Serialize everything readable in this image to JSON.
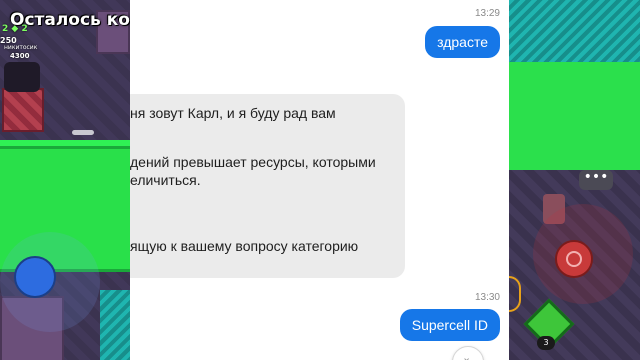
{
  "game": {
    "title": "Осталось ком",
    "stats_left": "2",
    "stats_gems": "2",
    "player_name": "никитосик",
    "player_score": "4300",
    "hp_left": "250",
    "super_count": "3",
    "chat_dots": "•••"
  },
  "chat": {
    "messages": [
      {
        "time": "13:29",
        "text": "здрасте"
      },
      {
        "time": "13:30",
        "text": "Supercell ID"
      }
    ],
    "reply_lines": [
      "ня зовут Карл, и я буду рад вам",
      "дений превышает ресурсы, которыми",
      "еличиться.",
      "ящую к вашему вопросу категорию"
    ],
    "scroll_icon": "chevron-down-icon"
  },
  "colors": {
    "accent": "#1677e8",
    "incoming_bubble": "#ebebeb",
    "grass": "#29e04a"
  }
}
